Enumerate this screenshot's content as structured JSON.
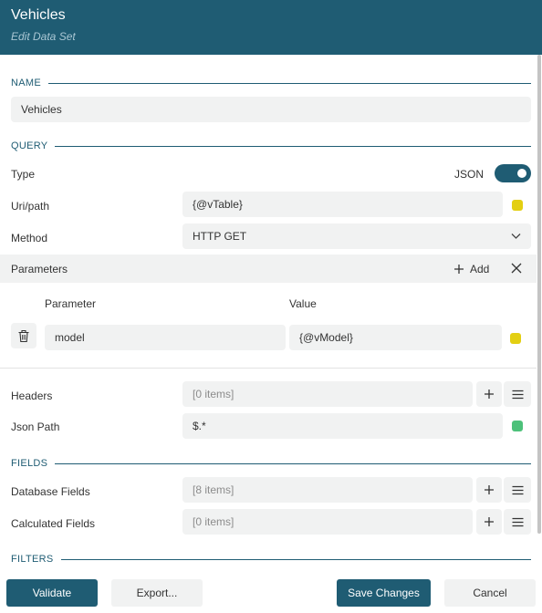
{
  "header": {
    "title": "Vehicles",
    "subtitle": "Edit Data Set"
  },
  "name_section": {
    "heading": "NAME",
    "value": "Vehicles"
  },
  "query": {
    "heading": "QUERY",
    "type_label": "Type",
    "type_value": "JSON",
    "type_toggle_on": true,
    "uri_label": "Uri/path",
    "uri_value": "{@vTable}",
    "uri_status_color": "#e3cf12",
    "method_label": "Method",
    "method_value": "HTTP GET"
  },
  "parameters": {
    "heading": "Parameters",
    "add_label": "Add",
    "col_parameter": "Parameter",
    "col_value": "Value",
    "rows": [
      {
        "parameter": "model",
        "value": "{@vModel}",
        "status_color": "#e3cf12"
      }
    ]
  },
  "headers_field": {
    "label": "Headers",
    "value": "[0 items]"
  },
  "json_path": {
    "label": "Json Path",
    "value": "$.*",
    "status_color": "#4dc17a"
  },
  "fields": {
    "heading": "FIELDS",
    "database_label": "Database Fields",
    "database_value": "[8 items]",
    "calculated_label": "Calculated Fields",
    "calculated_value": "[0 items]"
  },
  "filters": {
    "heading": "FILTERS"
  },
  "footer": {
    "validate": "Validate",
    "export": "Export...",
    "save": "Save Changes",
    "cancel": "Cancel"
  },
  "colors": {
    "accent": "#1f5c73",
    "input_bg": "#f1f2f2"
  }
}
